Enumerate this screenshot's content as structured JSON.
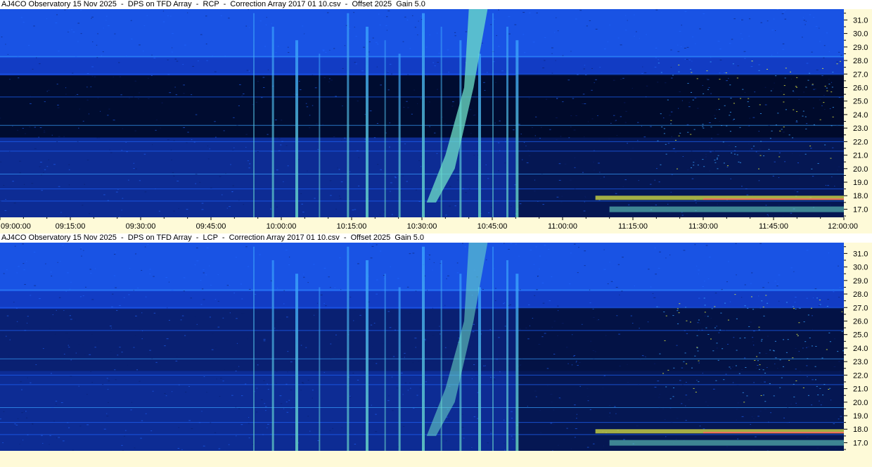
{
  "chart_data": [
    {
      "type": "heatmap",
      "title": "AJ4CO Observatory 15 Nov 2025  -  DPS on TFD Array  -  RCP  -  Correction Array 2017 01 10.csv  -  Offset 2025  Gain 5.0",
      "polarization": "RCP",
      "x_ticks": [
        "09:00:00",
        "09:15:00",
        "09:30:00",
        "09:45:00",
        "10:00:00",
        "10:15:00",
        "10:30:00",
        "10:45:00",
        "11:00:00",
        "11:15:00",
        "11:30:00",
        "11:45:00",
        "12:00:00"
      ],
      "y_ticks": [
        "31.0",
        "30.0",
        "29.0",
        "28.0",
        "27.0",
        "26.0",
        "25.0",
        "24.0",
        "23.0",
        "22.0",
        "21.0",
        "20.0",
        "19.0",
        "18.0",
        "17.0"
      ],
      "ylim": [
        16.4,
        31.8
      ],
      "bursts_minutes_from_0900": [
        54,
        58,
        63,
        68,
        74,
        78,
        82,
        85,
        90,
        94,
        98,
        102,
        105,
        108,
        110
      ],
      "colormap": [
        "#000a28",
        "#0a1f6e",
        "#123cc4",
        "#1f66ff",
        "#38a0ff",
        "#6ee0c8",
        "#e8f040",
        "#ff6060"
      ]
    },
    {
      "type": "heatmap",
      "title": "AJ4CO Observatory 15 Nov 2025  -  DPS on TFD Array  -  LCP  -  Correction Array 2017 01 10.csv  -  Offset 2025  Gain 5.0",
      "polarization": "LCP",
      "y_ticks": [
        "31.0",
        "30.0",
        "29.0",
        "28.0",
        "27.0",
        "26.0",
        "25.0",
        "24.0",
        "23.0",
        "22.0",
        "21.0",
        "20.0",
        "19.0",
        "18.0",
        "17.0"
      ],
      "ylim": [
        16.4,
        31.8
      ],
      "bursts_minutes_from_0900": [
        54,
        58,
        63,
        68,
        74,
        78,
        82,
        85,
        90,
        94,
        98,
        102,
        105,
        108,
        110
      ],
      "colormap": [
        "#000a28",
        "#0a1f6e",
        "#123cc4",
        "#1f66ff",
        "#38a0ff",
        "#6ee0c8",
        "#e8f040",
        "#ff6060"
      ]
    }
  ]
}
